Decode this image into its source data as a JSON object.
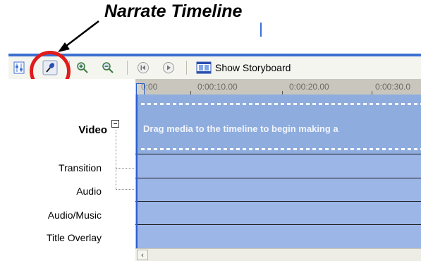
{
  "annotation": {
    "title": "Narrate Timeline"
  },
  "toolbar": {
    "storyboard_label": "Show Storyboard",
    "icons": [
      "set-audio-levels-icon",
      "narrate-timeline-icon",
      "zoom-in-icon",
      "zoom-out-icon",
      "rewind-icon",
      "play-icon",
      "storyboard-icon"
    ]
  },
  "ruler": {
    "ticks": [
      "0:00",
      "0:00:10.00",
      "0:00:20.00",
      "0:00:30.0"
    ]
  },
  "tracks": {
    "video": "Video",
    "transition": "Transition",
    "audio": "Audio",
    "audio_music": "Audio/Music",
    "title_overlay": "Title Overlay",
    "video_placeholder": "Drag media to the timeline to begin making a"
  },
  "colors": {
    "accent": "#3d6fd0",
    "track": "#9cb6e8",
    "highlight_circle": "#e01b1b"
  }
}
